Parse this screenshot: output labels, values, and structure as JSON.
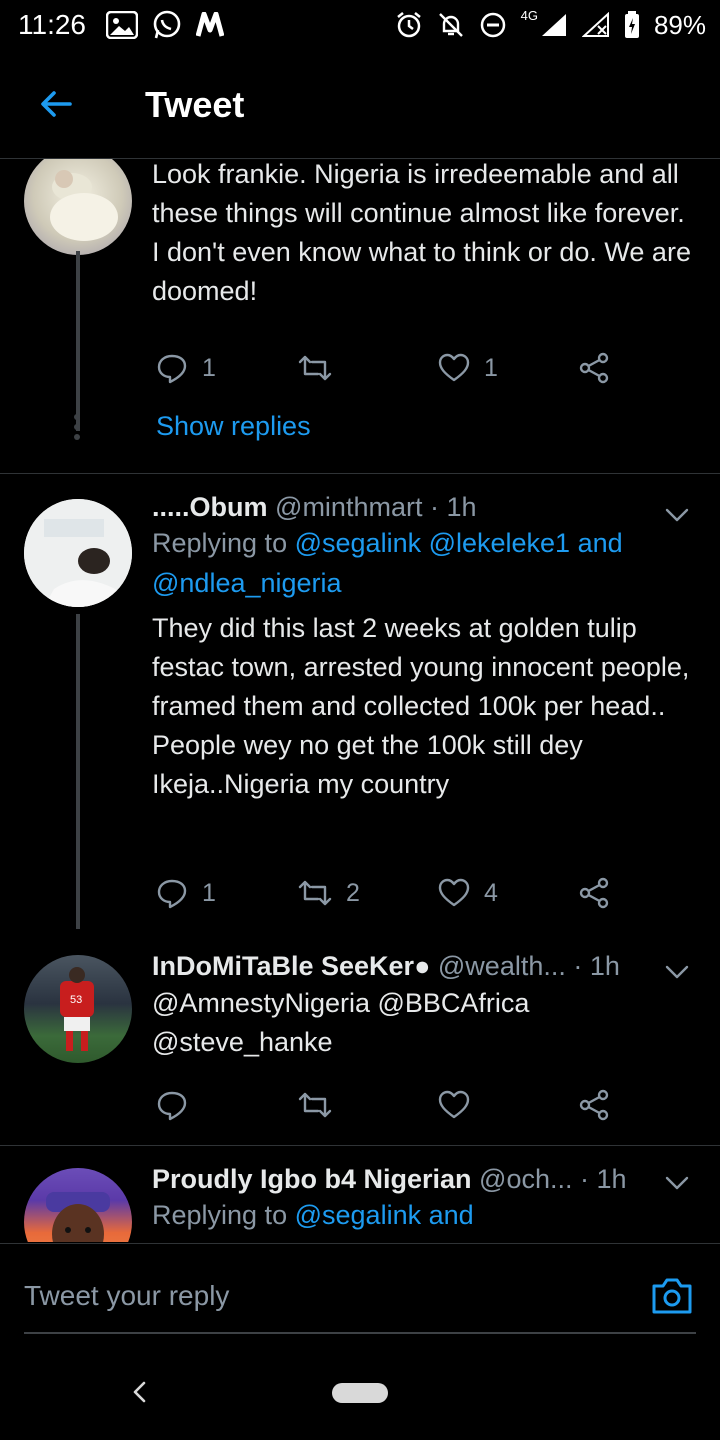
{
  "status_bar": {
    "time": "11:26",
    "network": "4G",
    "battery": "89%",
    "left_icons": [
      "photo-icon",
      "whatsapp-icon",
      "nairaland-icon"
    ],
    "right_icons": [
      "alarm-icon",
      "notifications-off-icon",
      "do-not-disturb-icon",
      "signal-icon",
      "battery-icon"
    ]
  },
  "header": {
    "title": "Tweet",
    "back_icon": "arrow-left-icon"
  },
  "tweets": [
    {
      "text": "Look frankie. Nigeria is irredeemable and all these things will continue almost like forever. I don't even know what to think or do. We are doomed!",
      "reply_count": "1",
      "retweet_count": "",
      "like_count": "1",
      "show_replies": "Show replies"
    },
    {
      "name": ".....Obum",
      "handle": "@minthmart",
      "time": "· 1h",
      "replying_prefix": "Replying to",
      "replying_to": "@segalink @lekeleke1 and @ndlea_nigeria",
      "text_1": "They did this last 2 weeks at golden tulip festac town, arrested young innocent people, framed them and collected 100k per head..",
      "text_2": "People wey no get the 100k still dey Ikeja..Nigeria my country",
      "reply_count": "1",
      "retweet_count": "2",
      "like_count": "4"
    },
    {
      "name": "InDoMiTaBle SeeKer●",
      "handle": "@wealth...",
      "time": "· 1h",
      "text": "@AmnestyNigeria @BBCAfrica @steve_hanke",
      "avatar_number": "53"
    },
    {
      "name": "Proudly Igbo b4 Nigerian",
      "handle": "@och...",
      "time": "· 1h",
      "replying_prefix": "Replying to",
      "replying_to": "@segalink and"
    }
  ],
  "compose": {
    "placeholder": "Tweet your reply",
    "camera_icon": "camera-icon"
  },
  "nav_bar": {
    "back_icon": "nav-back-icon",
    "home_icon": "home-pill-icon"
  },
  "colors": {
    "accent": "#1d9bf0",
    "background": "#000000",
    "muted": "#8b98a5",
    "text": "#e7e9ea"
  }
}
